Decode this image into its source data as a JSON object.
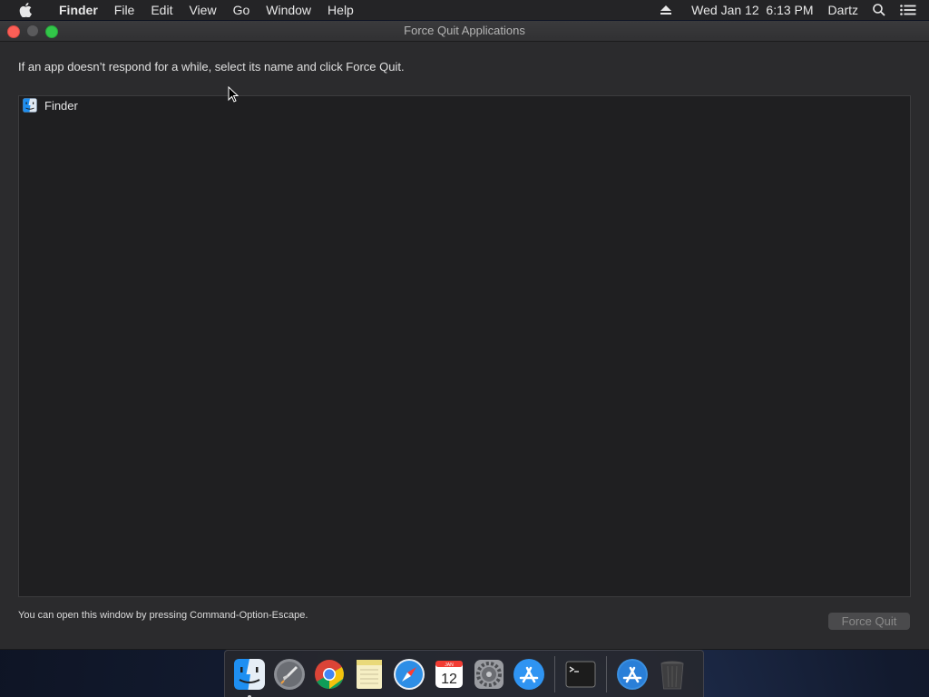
{
  "menubar": {
    "app_name": "Finder",
    "items": [
      "File",
      "Edit",
      "View",
      "Go",
      "Window",
      "Help"
    ],
    "clock": "Wed Jan 12  6:13 PM",
    "user": "Dartz",
    "icons": [
      "apple-icon",
      "eject-icon",
      "spotlight-icon",
      "notification-center-icon"
    ]
  },
  "window": {
    "title": "Force Quit Applications",
    "instruction": "If an app doesn’t respond for a while, select its name and click Force Quit.",
    "apps": [
      {
        "name": "Finder",
        "icon": "finder-icon"
      }
    ],
    "hint": "You can open this window by pressing Command-Option-Escape.",
    "force_quit_label": "Force Quit"
  },
  "dock": {
    "apps": [
      "finder-icon",
      "launchpad-icon",
      "chrome-icon",
      "notes-icon",
      "safari-icon",
      "calendar-icon",
      "system-preferences-icon",
      "app-store-icon",
      "terminal-icon",
      "app-store-downloads-icon",
      "trash-icon"
    ],
    "calendar_month": "JAN",
    "calendar_day": "12"
  },
  "colors": {
    "menubar_bg": "#242426",
    "window_bg": "#2b2b2d",
    "list_bg": "#1f1f21",
    "close": "#fc5f57",
    "zoom": "#32c649"
  }
}
